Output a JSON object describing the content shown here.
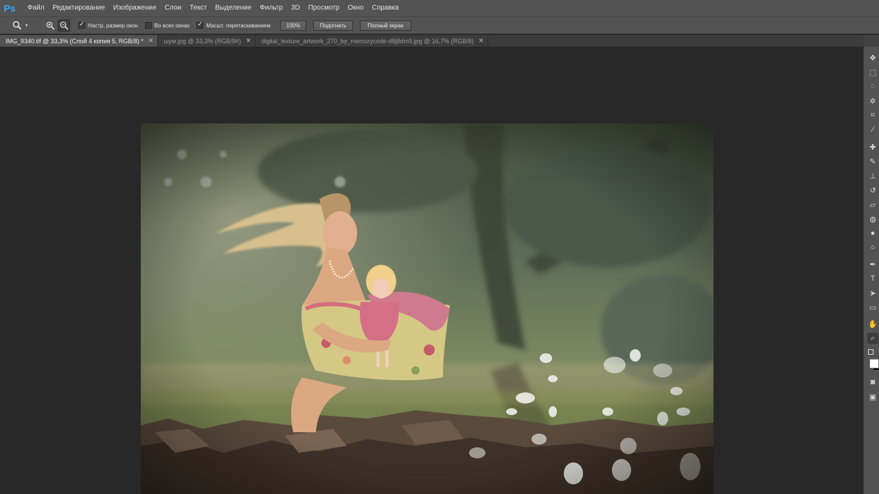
{
  "app": {
    "logo": "Ps"
  },
  "menu": [
    "Файл",
    "Редактирование",
    "Изображение",
    "Слои",
    "Текст",
    "Выделение",
    "Фильтр",
    "3D",
    "Просмотр",
    "Окно",
    "Справка"
  ],
  "options": {
    "tool_icon": "zoom-tool-icon",
    "resize_windows": {
      "label": "Настр. размер окон",
      "checked": true
    },
    "all_windows": {
      "label": "Во всех окнах",
      "checked": false
    },
    "scrubby_zoom": {
      "label": "Масшт. перетаскиванием",
      "checked": true
    },
    "btn_100": "100%",
    "btn_fit": "Подогнать",
    "btn_full": "Полный экран"
  },
  "tabs": [
    {
      "title": "IMG_9340.tif @ 33,3% (Слой 4 копия 5, RGB/8) *",
      "active": true
    },
    {
      "title": "шум.jpg @ 33,3% (RGB/8#)",
      "active": false
    },
    {
      "title": "digital_texture_artwork_270_by_mercurycode-d8j8dm9.jpg @ 16,7% (RGB/8)",
      "active": false
    }
  ],
  "canvas": {
    "background": "#282828",
    "image_content": "photo of a woman with windblown hair holding a doll, sitting on stones in a forest with falling petals"
  },
  "tools": [
    "move-tool-icon",
    "marquee-tool-icon",
    "lasso-tool-icon",
    "magic-wand-icon",
    "crop-tool-icon",
    "eyedropper-icon",
    "healing-brush-icon",
    "brush-tool-icon",
    "clone-stamp-icon",
    "history-brush-icon",
    "eraser-icon",
    "paint-bucket-icon",
    "blur-tool-icon",
    "dodge-tool-icon",
    "pen-tool-icon",
    "type-tool-icon",
    "path-selection-icon",
    "shape-tool-icon",
    "hand-tool-icon",
    "zoom-tool-icon"
  ],
  "colors": {
    "foreground": "#ffffff",
    "background": "#000000",
    "accent": "#31a8ff"
  }
}
